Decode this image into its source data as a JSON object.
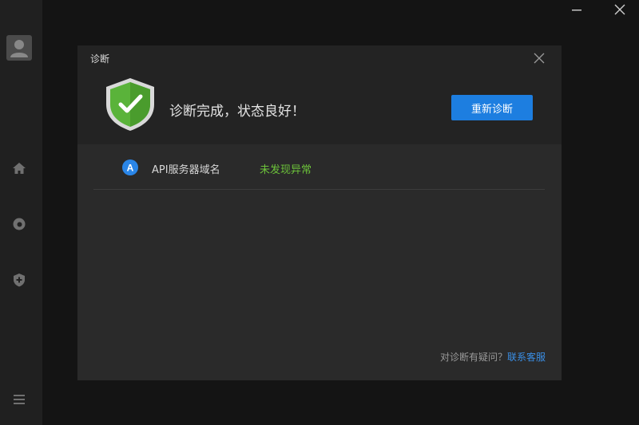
{
  "modal": {
    "title": "诊断",
    "status_message": "诊断完成，状态良好！",
    "rediagnose_label": "重新诊断"
  },
  "checks": [
    {
      "icon_letter": "A",
      "label": "API服务器域名",
      "status": "未发现异常"
    }
  ],
  "footer": {
    "question": "对诊断有疑问？",
    "link_label": "联系客服"
  },
  "icons": {
    "sidebar": [
      "avatar-icon",
      "home-icon",
      "speed-icon",
      "shield-plus-icon",
      "menu-icon"
    ],
    "window": [
      "minimize-icon",
      "close-icon"
    ],
    "status": "shield-check-icon"
  },
  "colors": {
    "accent": "#1d7ee0",
    "success": "#6cc23a",
    "shield_green": "#5ab33a",
    "link": "#3a8fe6"
  }
}
